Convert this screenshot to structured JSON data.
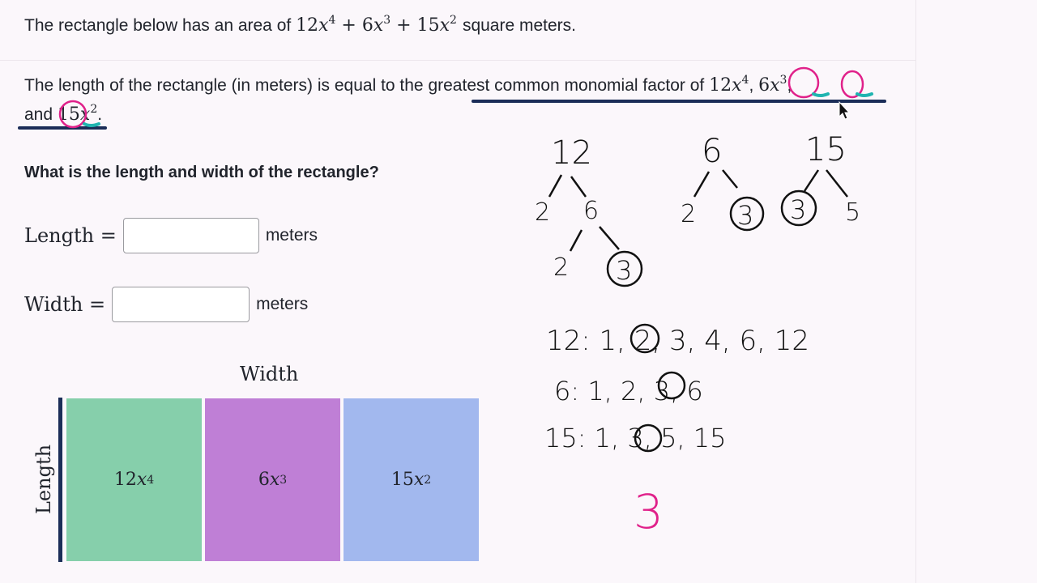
{
  "problem": {
    "area_prefix": "The rectangle below has an area of",
    "area_suffix": "square meters.",
    "length_prefix": "The length of the rectangle (in meters) is equal to the",
    "gcf_phrase": "greatest common monomial factor of",
    "and_word": "and",
    "terms": [
      {
        "coef": "12",
        "var": "x",
        "exp": "4"
      },
      {
        "coef": "6",
        "var": "x",
        "exp": "3"
      },
      {
        "coef": "15",
        "var": "x",
        "exp": "2"
      }
    ]
  },
  "question": "What is the length and width of the rectangle?",
  "fields": {
    "length": {
      "label": "Length =",
      "value": "",
      "unit": "meters"
    },
    "width": {
      "label": "Width =",
      "value": "",
      "unit": "meters"
    }
  },
  "diagram": {
    "width_label": "Width",
    "length_label": "Length",
    "segments": [
      {
        "coef": "12",
        "var": "x",
        "exp": "4",
        "color": "#86cfab"
      },
      {
        "coef": "6",
        "var": "x",
        "exp": "3",
        "color": "#bf7fd6"
      },
      {
        "coef": "15",
        "var": "x",
        "exp": "2",
        "color": "#a2b8ee"
      }
    ]
  },
  "handwriting": {
    "trees": [
      {
        "root": "12",
        "branch_left": "2",
        "branch_right": "6",
        "sub_left": "2",
        "sub_right": "3"
      },
      {
        "root": "6",
        "branch_left": "2",
        "branch_right": "3"
      },
      {
        "root": "15",
        "branch_left": "3",
        "branch_right": "5"
      }
    ],
    "factor_lists": [
      "12: 1, 2, 3, 4, 6, 12",
      "6: 1, 2, 3, 6",
      "15: 1, 3, 5, 15"
    ],
    "answer": "3",
    "ink_color": "#111111",
    "highlight_color": "#e0218a",
    "underline_color": "#1b2d58"
  }
}
